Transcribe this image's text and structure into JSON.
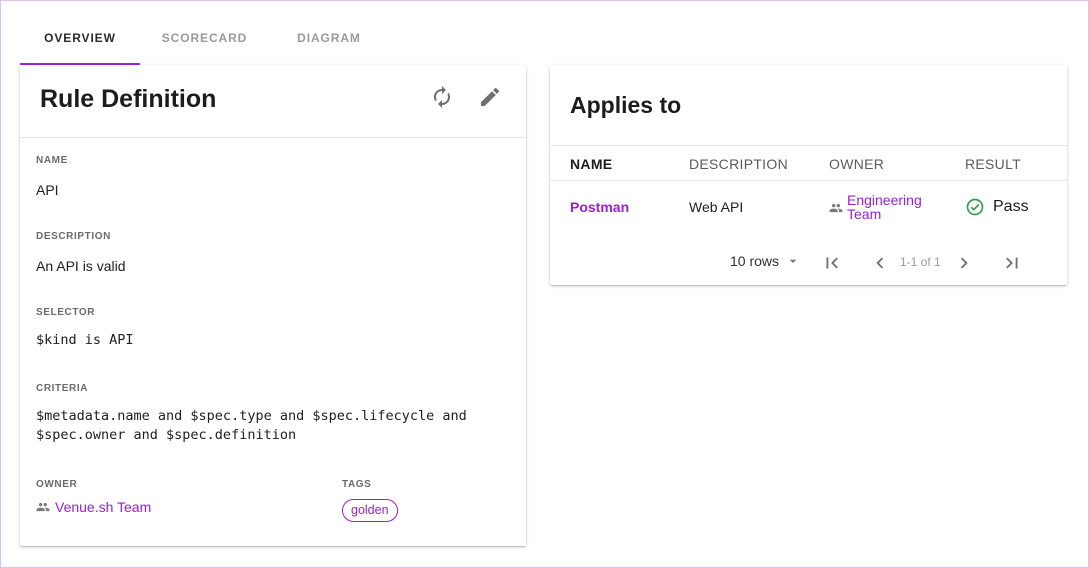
{
  "tabs": [
    {
      "label": "OVERVIEW",
      "active": true
    },
    {
      "label": "SCORECARD",
      "active": false
    },
    {
      "label": "DIAGRAM",
      "active": false
    }
  ],
  "rule_card": {
    "title": "Rule Definition",
    "icons": [
      "refresh-icon",
      "edit-pencil-icon"
    ],
    "name_label": "NAME",
    "name_value": "API",
    "description_label": "DESCRIPTION",
    "description_value": "An API is valid",
    "selector_label": "SELECTOR",
    "selector_value": "$kind is API",
    "criteria_label": "CRITERIA",
    "criteria_line1": "$metadata.name and $spec.type and $spec.lifecycle and",
    "criteria_line2": "$spec.owner and $spec.definition",
    "owner_label": "OWNER",
    "owner_value": "Venue.sh Team",
    "tags_label": "TAGS",
    "tags": [
      "golden"
    ]
  },
  "applies_card": {
    "title": "Applies to",
    "columns": [
      "NAME",
      "DESCRIPTION",
      "OWNER",
      "RESULT"
    ],
    "rows": [
      {
        "name": "Postman",
        "description": "Web API",
        "owner_line1": "Engineering",
        "owner_line2": "Team",
        "result": "Pass"
      }
    ],
    "pagination": {
      "rows_per_page": "10 rows",
      "range": "1-1 of 1"
    }
  },
  "colors": {
    "accent": "#9a1fd0",
    "pass_green": "#2e9d4a"
  }
}
